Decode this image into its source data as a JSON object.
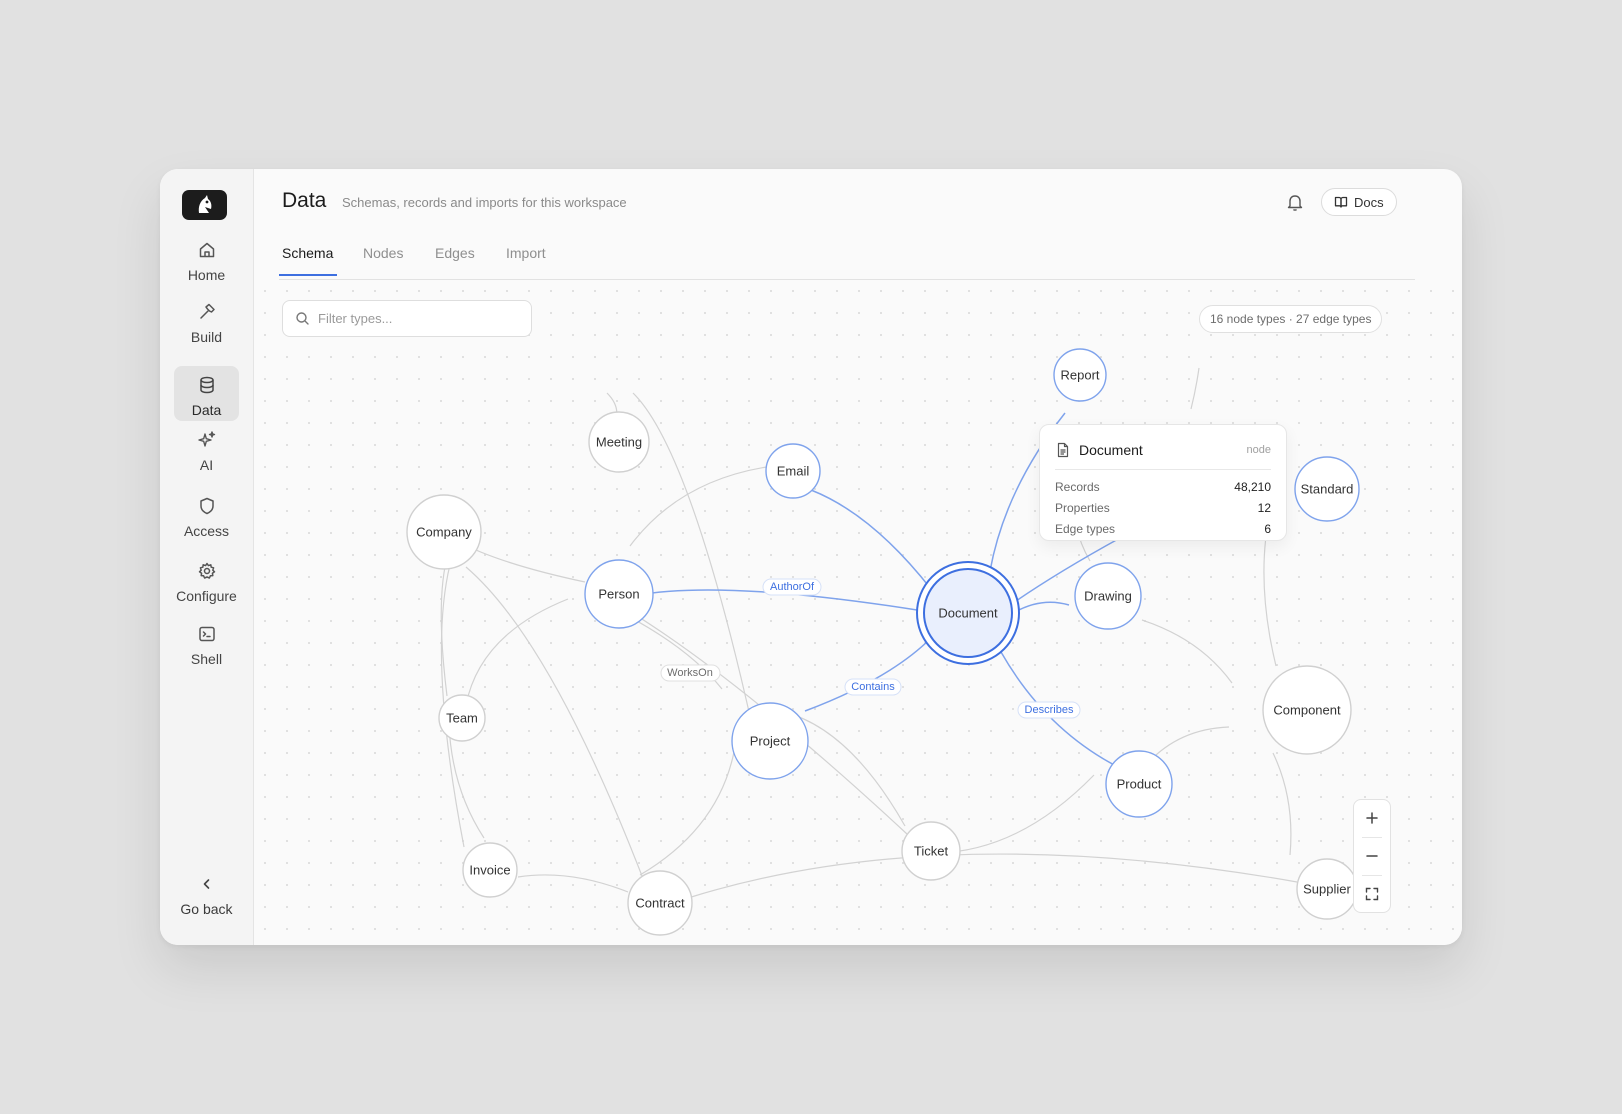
{
  "nav": {
    "items": [
      {
        "label": "Home",
        "icon": "home-icon"
      },
      {
        "label": "Build",
        "icon": "hammer-icon"
      },
      {
        "label": "Data",
        "icon": "database-icon"
      },
      {
        "label": "AI",
        "icon": "sparkles-icon"
      },
      {
        "label": "Access",
        "icon": "shield-icon"
      },
      {
        "label": "Configure",
        "icon": "gear-icon"
      },
      {
        "label": "Shell",
        "icon": "terminal-icon"
      }
    ],
    "active": "Data",
    "go_back": "Go back"
  },
  "header": {
    "title": "Data",
    "subtitle": "Schemas, records and imports for this workspace",
    "docs_label": "Docs"
  },
  "tabs": [
    {
      "label": "Schema"
    },
    {
      "label": "Nodes"
    },
    {
      "label": "Edges"
    },
    {
      "label": "Import"
    }
  ],
  "active_tab": "Schema",
  "filter": {
    "placeholder": "Filter types...",
    "value": ""
  },
  "counts_label": "16 node types · 27 edge types",
  "graph": {
    "nodes": [
      "Report",
      "Meeting",
      "Email",
      "Standard",
      "Company",
      "Person",
      "Document",
      "Drawing",
      "Team",
      "Project",
      "Component",
      "Product",
      "Ticket",
      "Invoice",
      "Contract",
      "Supplier"
    ],
    "selected": "Document",
    "highlighted": [
      "Report",
      "Email",
      "Standard",
      "Person",
      "Drawing",
      "Project",
      "Product"
    ],
    "edge_labels": [
      "AuthorOf",
      "WorksOn",
      "Contains",
      "Describes"
    ]
  },
  "tooltip": {
    "title": "Document",
    "kind": "node",
    "rows": [
      {
        "key": "Records",
        "value": "48,210"
      },
      {
        "key": "Properties",
        "value": "12"
      },
      {
        "key": "Edge types",
        "value": "6"
      }
    ]
  },
  "colors": {
    "accent": "#3d6fe0",
    "highlight_edge": "#7fa3ec",
    "muted_edge": "#d2d2d2",
    "selected_fill": "#e9effd"
  }
}
